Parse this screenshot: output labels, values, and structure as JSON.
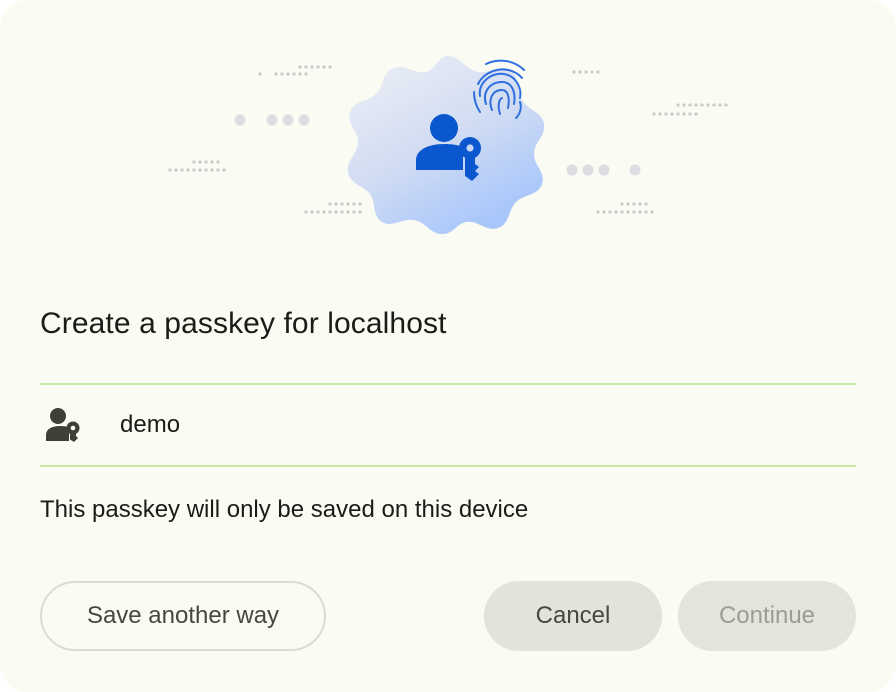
{
  "dialog": {
    "title": "Create a passkey for localhost",
    "account": {
      "icon": "passkey-user-icon",
      "name": "demo"
    },
    "note": "This passkey will only be saved on this device",
    "buttons": {
      "save_another_way": "Save another way",
      "cancel": "Cancel",
      "continue": "Continue"
    },
    "continue_enabled": false
  },
  "hero": {
    "illustration": "passkey-illustration",
    "badge_icon": "user-key-icon",
    "accent_icon": "fingerprint-icon"
  },
  "colors": {
    "background": "#fafbf3",
    "primary": "#0b57d0",
    "divider": "#c9e9a8",
    "text": "#1b1c18",
    "tonal_button": "#e1e4d9",
    "disabled_text": "#9a9d93"
  }
}
